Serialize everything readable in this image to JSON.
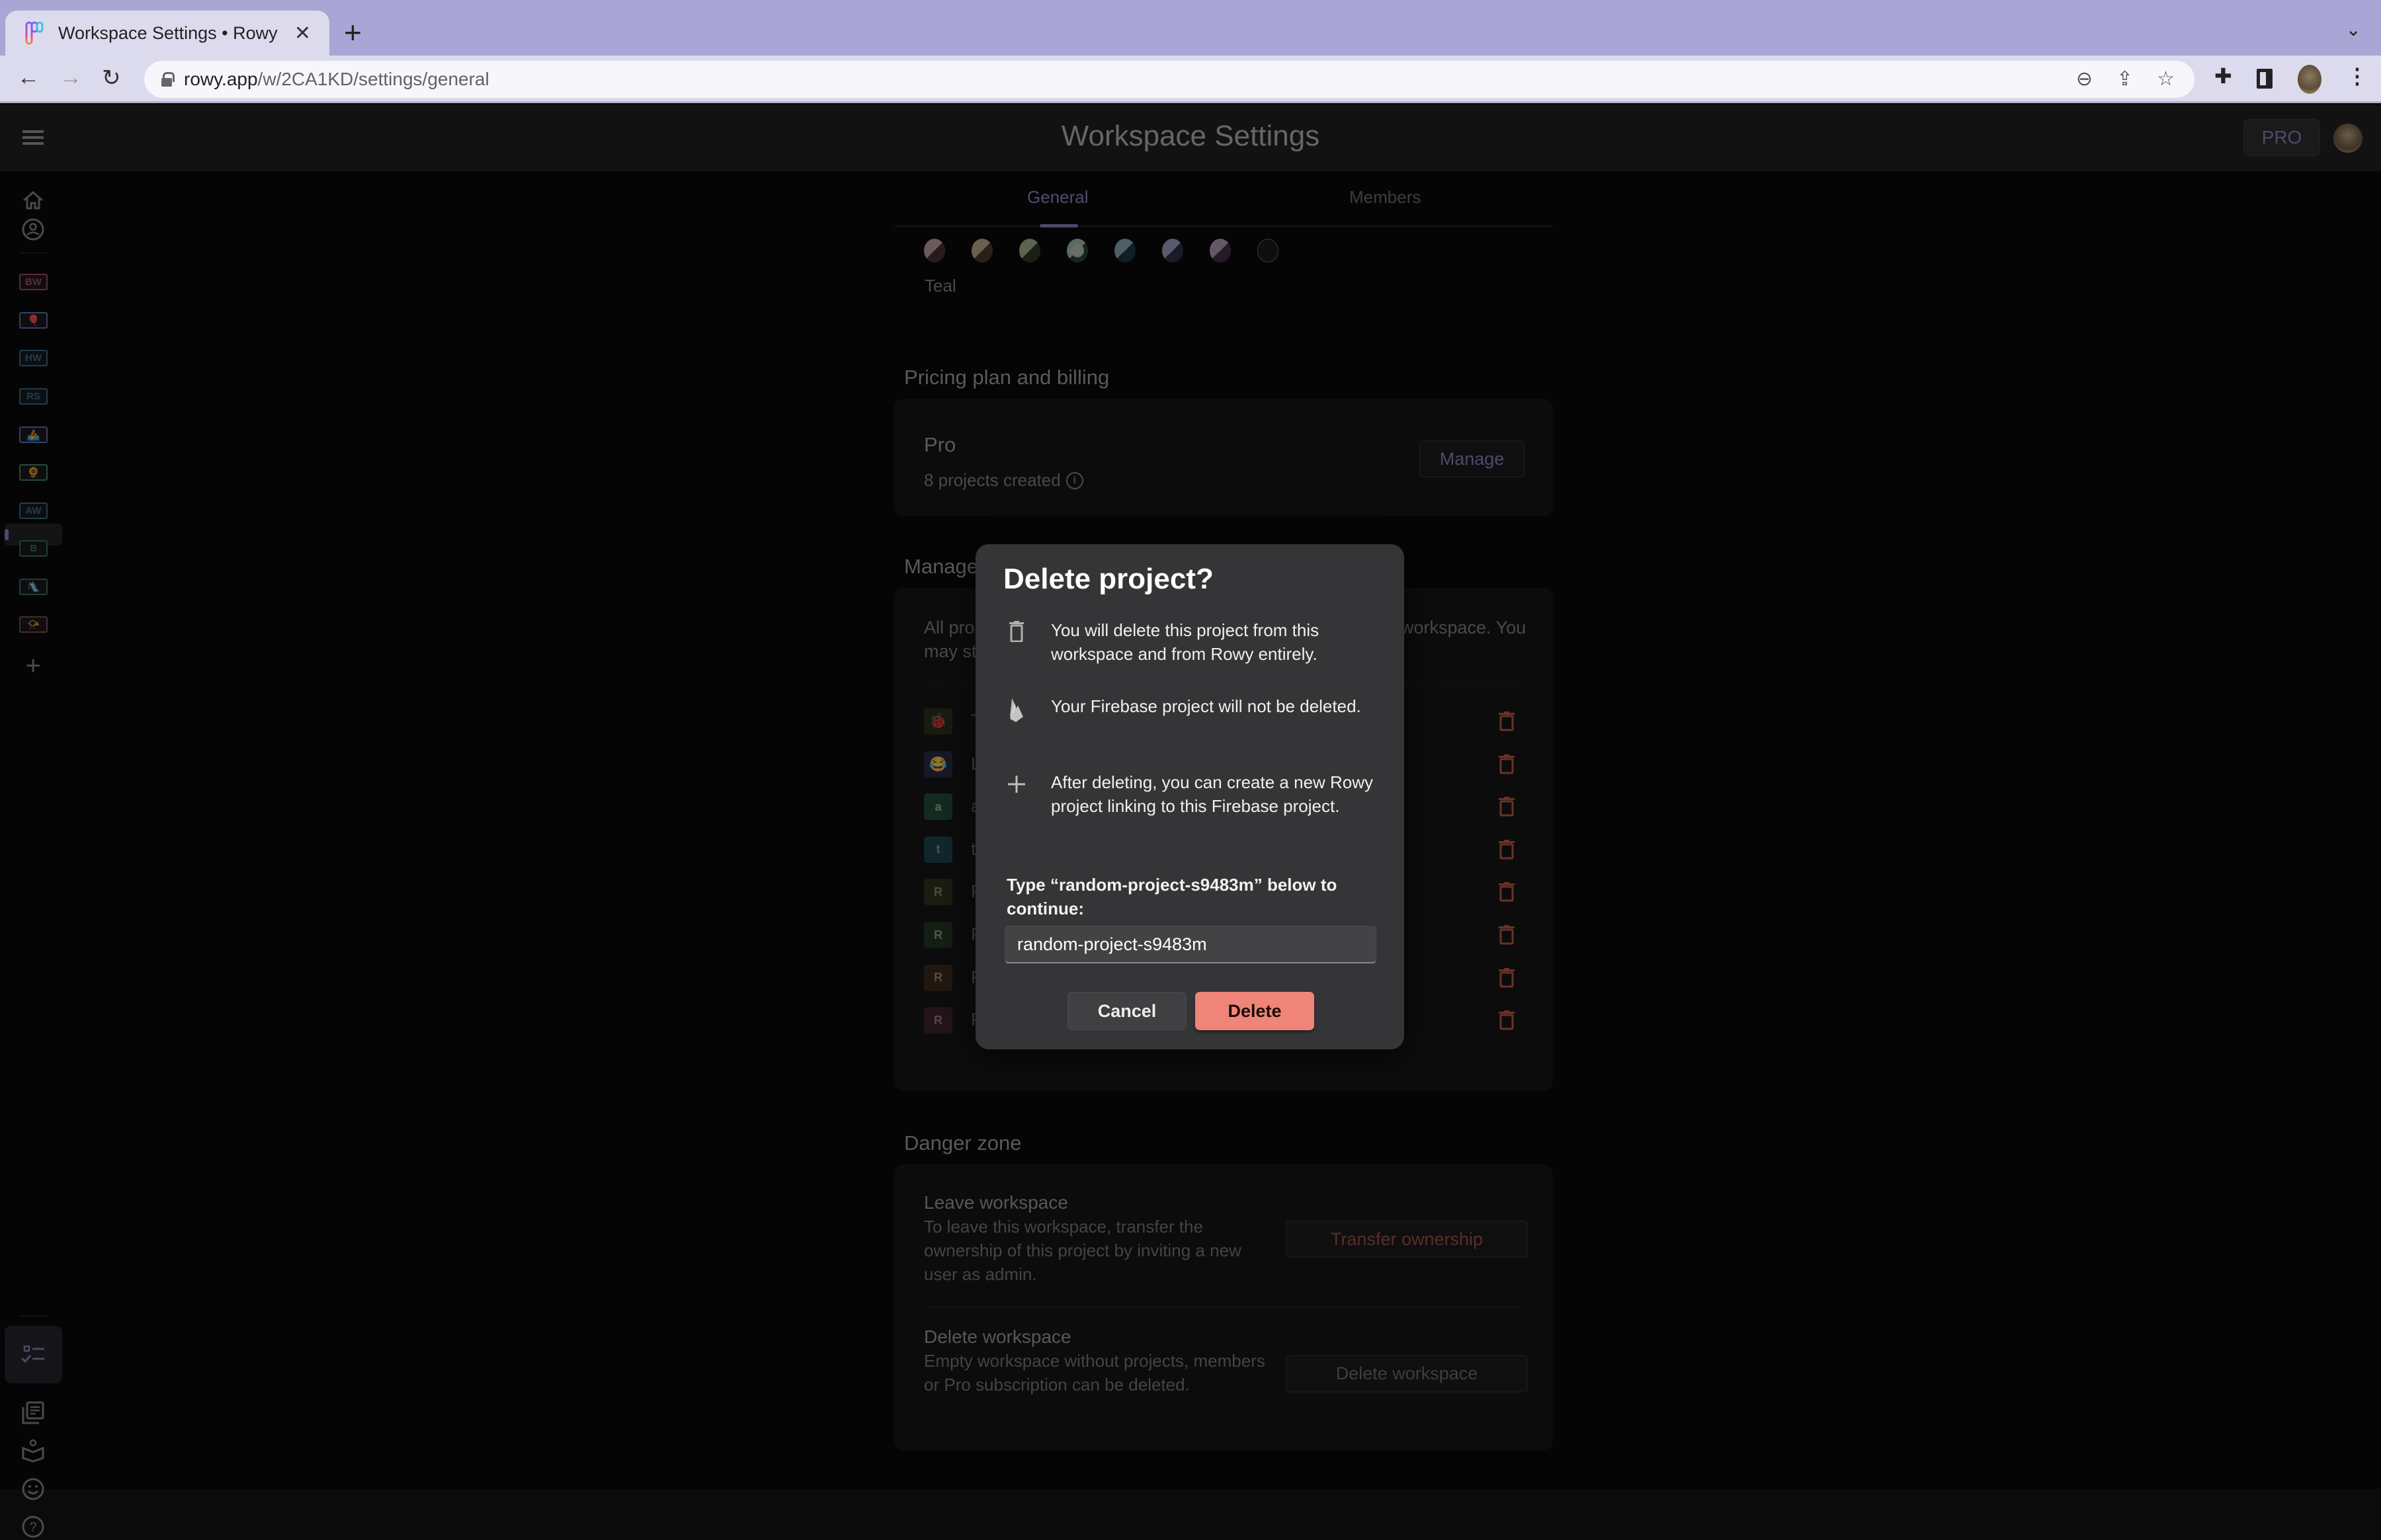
{
  "browser": {
    "tab_title": "Workspace Settings • Rowy",
    "url_host": "rowy.app",
    "url_path": "/w/2CA1KD/settings/general"
  },
  "app": {
    "title": "Workspace Settings",
    "plan_badge": "PRO",
    "tabs": [
      {
        "label": "General",
        "active": true
      },
      {
        "label": "Members",
        "active": false
      }
    ]
  },
  "sidebar": {
    "workspaces": [
      {
        "label": "BW",
        "type": "text",
        "color": "#5c2b35"
      },
      {
        "label": "🎈",
        "type": "emoji",
        "color": "#3a3f5c"
      },
      {
        "label": "HW",
        "type": "text",
        "color": "#1f3f4a"
      },
      {
        "label": "RS",
        "type": "text",
        "color": "#1f3f4a"
      },
      {
        "label": "🚣",
        "type": "emoji",
        "color": "#3a3f5c"
      },
      {
        "label": "🌻",
        "type": "emoji",
        "color": "#2b4a3a",
        "active": true
      },
      {
        "label": "AW",
        "type": "text",
        "color": "#1f3f4a"
      },
      {
        "label": "B",
        "type": "text",
        "color": "#1f3f30"
      },
      {
        "label": "🛝",
        "type": "emoji",
        "color": "#1f3f30"
      },
      {
        "label": "📯",
        "type": "emoji",
        "color": "#4a2a2a"
      }
    ]
  },
  "theme": {
    "selected_color_label": "Teal",
    "swatches": [
      {
        "name": "red",
        "light": "#6a5a5a",
        "dark": "#2a1a1c"
      },
      {
        "name": "orange",
        "light": "#6a6050",
        "dark": "#2a2016"
      },
      {
        "name": "green",
        "light": "#5a6450",
        "dark": "#1a2016"
      },
      {
        "name": "teal",
        "light": "#5a6a60",
        "dark": "#16261e",
        "selected": true
      },
      {
        "name": "cyan",
        "light": "#4e5e66",
        "dark": "#0e2026"
      },
      {
        "name": "blue",
        "light": "#585a6e",
        "dark": "#181c2a"
      },
      {
        "name": "purple",
        "light": "#625866",
        "dark": "#261a26"
      },
      {
        "name": "none",
        "light": "#0e0e10",
        "dark": "#0e0e10"
      }
    ]
  },
  "pricing": {
    "section_title": "Pricing plan and billing",
    "plan_name": "Pro",
    "projects_created": "8 projects created",
    "manage_label": "Manage"
  },
  "manage_projects": {
    "section_title": "Manage",
    "description_line1": "All pro",
    "description_line1_end": "workspace. You",
    "description_line2": "may st",
    "projects": [
      {
        "icon": "🐞",
        "type": "emoji",
        "name": "T",
        "color": "#1a1a10"
      },
      {
        "icon": "😂",
        "type": "emoji",
        "name": "L",
        "color": "#141828"
      },
      {
        "icon": "a",
        "type": "text",
        "name": "a",
        "color": "#142a20",
        "text_color": "#4a6a5a"
      },
      {
        "icon": "t",
        "type": "text",
        "name": "t",
        "color": "#10262a",
        "text_color": "#3e5a5a"
      },
      {
        "icon": "R",
        "type": "text",
        "name": "R",
        "color": "#1a1c12",
        "text_color": "#4a4e3a"
      },
      {
        "icon": "R",
        "type": "text",
        "name": "R",
        "color": "#141e14",
        "text_color": "#4a5a48"
      },
      {
        "icon": "R",
        "type": "text",
        "name": "R",
        "color": "#201810",
        "text_color": "#5a4a3a"
      },
      {
        "icon": "R",
        "type": "text",
        "name": "R",
        "color": "#221418",
        "text_color": "#5a4448"
      }
    ]
  },
  "danger_zone": {
    "section_title": "Danger zone",
    "leave_title": "Leave workspace",
    "leave_desc": "To leave this workspace, transfer the ownership of this project by inviting a new user as admin.",
    "transfer_label": "Transfer ownership",
    "delete_title": "Delete workspace",
    "delete_desc": "Empty workspace without projects, members or Pro subscription can be deleted.",
    "delete_label": "Delete workspace"
  },
  "dialog": {
    "title": "Delete project?",
    "items": [
      {
        "icon": "trash-icon",
        "text": "You will delete this project from this workspace and from Rowy entirely."
      },
      {
        "icon": "firebase-icon",
        "text": "Your Firebase project will not be deleted."
      },
      {
        "icon": "plus-icon",
        "text": "After deleting, you can create a new Rowy project linking to this Firebase project."
      }
    ],
    "confirm_label": "Type “random-project-s9483m” below to continue:",
    "input_value": "random-project-s9483m",
    "cancel_label": "Cancel",
    "delete_label": "Delete",
    "delete_color": "#ef8579"
  }
}
